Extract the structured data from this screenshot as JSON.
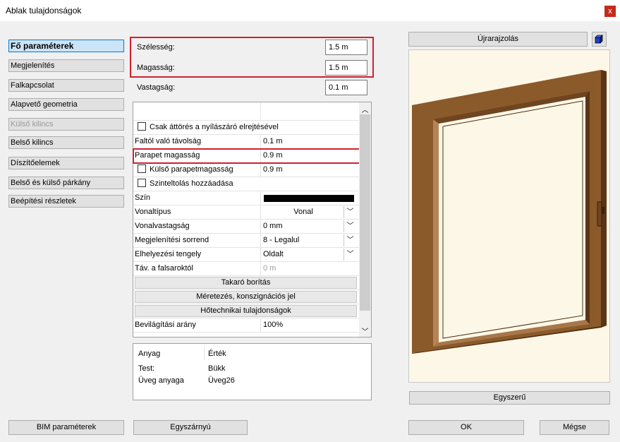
{
  "window": {
    "title": "Ablak tulajdonságok",
    "close_glyph": "x"
  },
  "nav": {
    "items": [
      {
        "label": "Fő paraméterek",
        "state": "active"
      },
      {
        "label": "Megjelenítés",
        "state": "normal"
      },
      {
        "label": "Falkapcsolat",
        "state": "normal"
      },
      {
        "label": "Alapvető geometria",
        "state": "normal"
      },
      {
        "label": "Külső kilincs",
        "state": "disabled"
      },
      {
        "label": "Belső kilincs",
        "state": "normal"
      },
      {
        "label": "Díszítőelemek",
        "state": "normal"
      },
      {
        "label": "Belső és külső párkány",
        "state": "normal"
      },
      {
        "label": "Beépítési részletek",
        "state": "normal"
      }
    ]
  },
  "params": {
    "width": {
      "label": "Szélesség:",
      "value": "1.5 m"
    },
    "height": {
      "label": "Magasság:",
      "value": "1.5 m"
    },
    "thickness": {
      "label": "Vastagság:",
      "value": "0.1 m"
    }
  },
  "grid": {
    "rows": {
      "r1": {
        "label": "Csak áttörés a nyílászáró elrejtésével"
      },
      "r2": {
        "label": "Faltól való távolság",
        "value": "0.1 m"
      },
      "r3": {
        "label": "Parapet magasság",
        "value": "0.9 m"
      },
      "r4": {
        "label": "Külső parapetmagasság",
        "value": "0.9 m"
      },
      "r5": {
        "label": "Szinteltolás hozzáadása"
      },
      "r6": {
        "label": "Szín"
      },
      "r7": {
        "label": "Vonaltípus",
        "value": "Vonal"
      },
      "r8": {
        "label": "Vonalvastagság",
        "value": "0 mm"
      },
      "r9": {
        "label": "Megjelenítési sorrend",
        "value": "8 - Legalul"
      },
      "r10": {
        "label": "Elhelyezési tengely",
        "value": "Oldalt"
      },
      "r11": {
        "label": "Táv. a falsaroktól",
        "value": "0 m"
      },
      "r12": {
        "label": "Takaró borítás"
      },
      "r13": {
        "label": "Méretezés, konszignációs jel"
      },
      "r14": {
        "label": "Hőtechnikai tulajdonságok"
      },
      "r15": {
        "label": "Bevilágítási arány",
        "value": "100%"
      }
    },
    "color_value": "#000000",
    "scroll_up": "︿",
    "scroll_down": "﹀"
  },
  "material": {
    "header_col1": "Anyag",
    "header_col2": "Érték",
    "rows": [
      {
        "name": "Test:",
        "value": "Bükk"
      },
      {
        "name": "Üveg anyaga",
        "value": "Üveg26"
      }
    ]
  },
  "preview": {
    "redraw_label": "Újrarajzolás",
    "simple_label": "Egyszerű",
    "frame_color": "#8b5a2b"
  },
  "footer": {
    "bim_label": "BIM paraméterek",
    "single_sash_label": "Egyszárnyú",
    "ok_label": "OK",
    "cancel_label": "Mégse"
  }
}
